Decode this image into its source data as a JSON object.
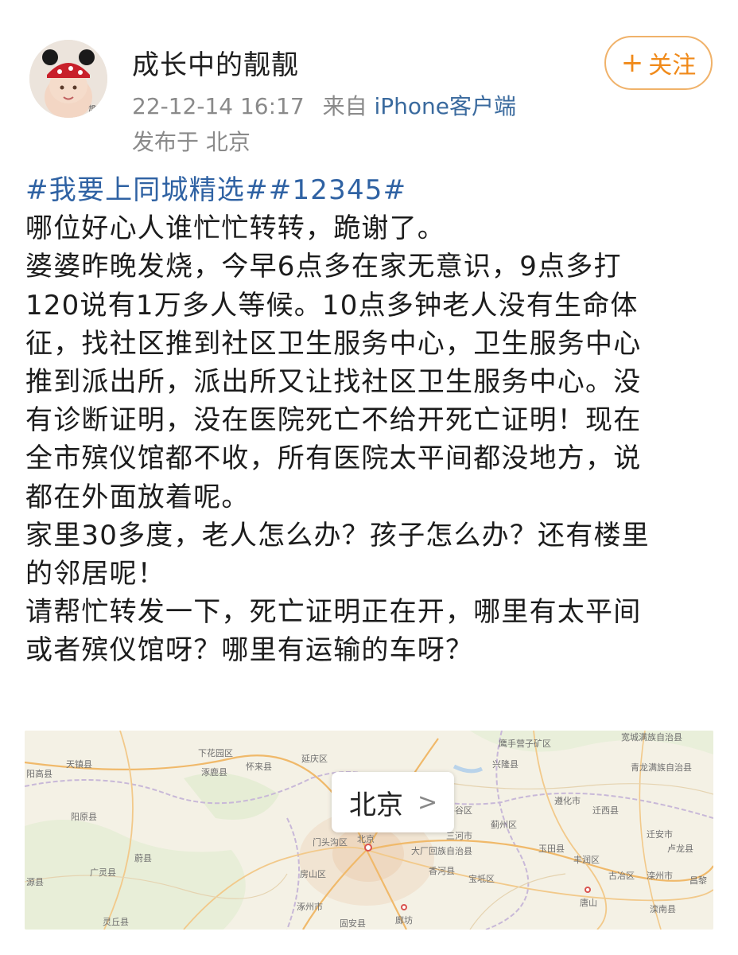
{
  "post": {
    "author": "成长中的靓靓",
    "timestamp": "22-12-14 16:17",
    "from_label": "来自",
    "source": "iPhone客户端",
    "location": "发布于 北京",
    "follow_plus": "+",
    "follow_label": "关注",
    "topics": "#我要上同城精选##12345#",
    "lines": [
      "哪位好心人谁忙忙转转，跪谢了。",
      "婆婆昨晚发烧，今早6点多在家无意识，9点多打",
      "120说有1万多人等候。10点多钟老人没有生命体",
      "征，找社区推到社区卫生服务中心，卫生服务中心",
      "推到派出所，派出所又让找社区卫生服务中心。没",
      "有诊断证明，没在医院死亡不给开死亡证明！现在",
      "全市殡仪馆都不收，所有医院太平间都没地方，说",
      "都在外面放着呢。",
      "家里30多度，老人怎么办？孩子怎么办？还有楼里",
      "的邻居呢！",
      "请帮忙转发一下，死亡证明正在开，哪里有太平间",
      "或者殡仪馆呀？哪里有运输的车呀？"
    ]
  },
  "map": {
    "callout_label": "北京",
    "callout_arrow": ">",
    "places": {
      "p1": "下花园区",
      "p2": "怀来县",
      "p3": "延庆区",
      "p4": "天镇县",
      "p5": "阳高县",
      "p6": "涿鹿县",
      "p7": "阳原县",
      "p8": "门头沟区",
      "p9": "北京",
      "p10": "房山区",
      "p11": "涿州市",
      "p12": "蔚县",
      "p13": "广灵县",
      "p14": "源县",
      "p15": "灵丘县",
      "p16": "廊坊",
      "p17": "大厂回族自治县",
      "p18": "香河县",
      "p19": "宝坻区",
      "p20": "三河市",
      "p21": "平谷区",
      "p22": "蓟州区",
      "p23": "兴隆县",
      "p24": "鹰手营子矿区",
      "p25": "遵化市",
      "p26": "玉田县",
      "p27": "丰润区",
      "p28": "迁西县",
      "p29": "迁安市",
      "p30": "唐山",
      "p31": "古冶区",
      "p32": "滦州市",
      "p33": "卢龙县",
      "p34": "青龙满族自治县",
      "p35": "滦南县",
      "p36": "昌黎",
      "p37": "宽城满族自治县",
      "p38": "固安县"
    }
  },
  "colors": {
    "topic": "#2f62a3",
    "follow": "#f08a1a",
    "meta": "#8a8a8a",
    "source": "#3a6a9e"
  }
}
